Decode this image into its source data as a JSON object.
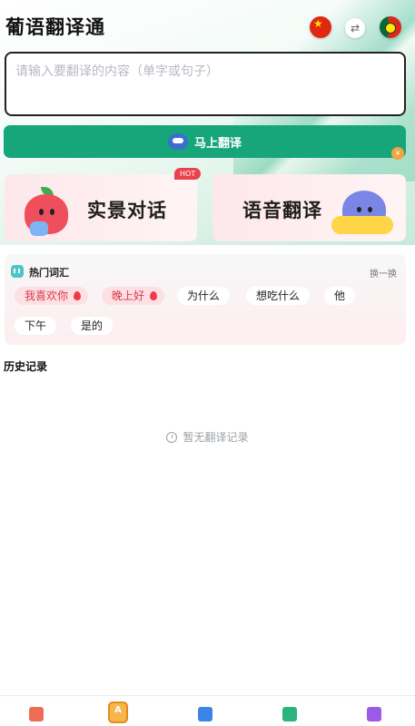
{
  "app": {
    "title": "葡语翻译通"
  },
  "header": {
    "source_flag_icon": "china-flag-icon",
    "swap_icon": "swap-arrows-icon",
    "target_flag_icon": "portugal-flag-icon"
  },
  "input": {
    "placeholder": "请输入要翻译的内容（单字或句子）",
    "value": ""
  },
  "translate_button": {
    "label": "马上翻译"
  },
  "cards": {
    "scene": {
      "title": "实景对话",
      "badge": "HOT"
    },
    "voice": {
      "title": "语音翻译"
    }
  },
  "hot_words": {
    "title": "热门词汇",
    "refresh_label": "换一换",
    "chips": [
      "我喜欢你",
      "晚上好",
      "为什么",
      "想吃什么",
      "他",
      "下午",
      "是的"
    ],
    "hot_flags": [
      true,
      true,
      false,
      false,
      false,
      false,
      false
    ]
  },
  "history": {
    "title": "历史记录",
    "empty_text": "暂无翻译记录"
  },
  "tabbar": {
    "icons": [
      "video-icon",
      "translate-icon",
      "book-icon",
      "notebook-icon",
      "list-icon"
    ],
    "active_index": 1
  },
  "colors": {
    "primary": "#17a57a",
    "hot": "#e8434d",
    "chip_hot_bg": "#fde0e3"
  }
}
